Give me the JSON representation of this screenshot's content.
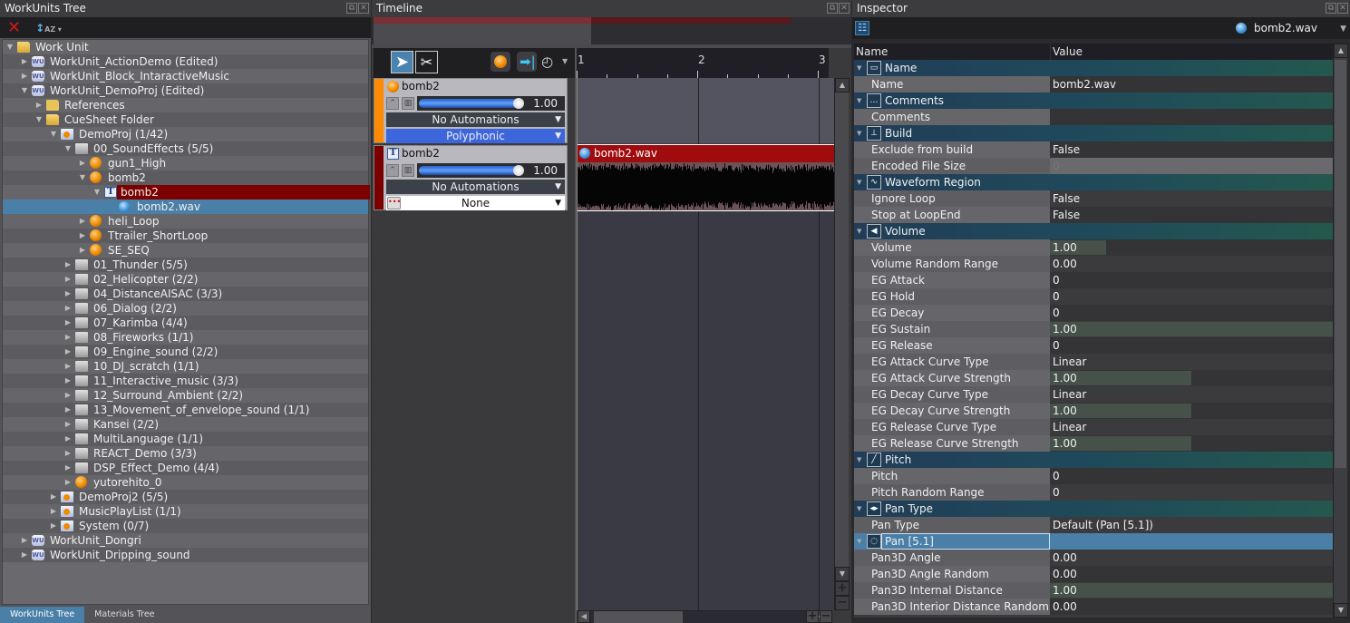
{
  "left_panel": {
    "title": "WorkUnits Tree",
    "toolbar": {
      "delete_icon": "delete-x-icon",
      "sort_icon": "sort-az-icon"
    },
    "tree": [
      {
        "label": "Work Unit",
        "icon": "folder-open",
        "depth": 0,
        "expanded": true
      },
      {
        "label": "WorkUnit_ActionDemo (Edited)",
        "icon": "workunit",
        "depth": 1,
        "expanded": false
      },
      {
        "label": "WorkUnit_Block_IntaractiveMusic",
        "icon": "workunit",
        "depth": 1,
        "expanded": false
      },
      {
        "label": "WorkUnit_DemoProj (Edited)",
        "icon": "workunit",
        "depth": 1,
        "expanded": true
      },
      {
        "label": "References",
        "icon": "folder",
        "depth": 2,
        "expanded": false
      },
      {
        "label": "CueSheet Folder",
        "icon": "folder-open",
        "depth": 2,
        "expanded": true
      },
      {
        "label": "DemoProj (1/42)",
        "icon": "cuesheet",
        "depth": 3,
        "expanded": true
      },
      {
        "label": "00_SoundEffects (5/5)",
        "icon": "gray-folder-open",
        "depth": 4,
        "expanded": true
      },
      {
        "label": "gun1_High",
        "icon": "cue",
        "depth": 5,
        "expanded": false
      },
      {
        "label": "bomb2",
        "icon": "cue",
        "depth": 5,
        "expanded": true
      },
      {
        "label": "bomb2",
        "icon": "track",
        "depth": 6,
        "expanded": true,
        "selected": "red"
      },
      {
        "label": "bomb2.wav",
        "icon": "waveform",
        "depth": 7,
        "selected": "blue"
      },
      {
        "label": "heli_Loop",
        "icon": "cue",
        "depth": 5,
        "expanded": false
      },
      {
        "label": "Ttrailer_ShortLoop",
        "icon": "cue",
        "depth": 5,
        "expanded": false
      },
      {
        "label": "SE_SEQ",
        "icon": "cue",
        "depth": 5,
        "expanded": false
      },
      {
        "label": "01_Thunder (5/5)",
        "icon": "gray-folder",
        "depth": 4,
        "expanded": false
      },
      {
        "label": "02_Helicopter (2/2)",
        "icon": "gray-folder",
        "depth": 4,
        "expanded": false
      },
      {
        "label": "04_DistanceAISAC (3/3)",
        "icon": "gray-folder",
        "depth": 4,
        "expanded": false
      },
      {
        "label": "06_Dialog (2/2)",
        "icon": "gray-folder",
        "depth": 4,
        "expanded": false
      },
      {
        "label": "07_Karimba (4/4)",
        "icon": "gray-folder",
        "depth": 4,
        "expanded": false
      },
      {
        "label": "08_Fireworks (1/1)",
        "icon": "gray-folder",
        "depth": 4,
        "expanded": false
      },
      {
        "label": "09_Engine_sound (2/2)",
        "icon": "gray-folder",
        "depth": 4,
        "expanded": false
      },
      {
        "label": "10_DJ_scratch (1/1)",
        "icon": "gray-folder",
        "depth": 4,
        "expanded": false
      },
      {
        "label": "11_Interactive_music (3/3)",
        "icon": "gray-folder",
        "depth": 4,
        "expanded": false
      },
      {
        "label": "12_Surround_Ambient (2/2)",
        "icon": "gray-folder",
        "depth": 4,
        "expanded": false
      },
      {
        "label": "13_Movement_of_envelope_sound (1/1)",
        "icon": "gray-folder",
        "depth": 4,
        "expanded": false
      },
      {
        "label": "Kansei (2/2)",
        "icon": "gray-folder",
        "depth": 4,
        "expanded": false
      },
      {
        "label": "MultiLanguage (1/1)",
        "icon": "gray-folder",
        "depth": 4,
        "expanded": false
      },
      {
        "label": "REACT_Demo (3/3)",
        "icon": "gray-folder",
        "depth": 4,
        "expanded": false
      },
      {
        "label": "DSP_Effect_Demo (4/4)",
        "icon": "gray-folder",
        "depth": 4,
        "expanded": false
      },
      {
        "label": "yutorehito_0",
        "icon": "cue",
        "depth": 4,
        "expanded": false
      },
      {
        "label": "DemoProj2 (5/5)",
        "icon": "cuesheet",
        "depth": 3,
        "expanded": false
      },
      {
        "label": "MusicPlayList (1/1)",
        "icon": "cuesheet",
        "depth": 3,
        "expanded": false
      },
      {
        "label": "System (0/7)",
        "icon": "cuesheet",
        "depth": 3,
        "expanded": false
      },
      {
        "label": "WorkUnit_Dongri",
        "icon": "workunit",
        "depth": 1,
        "expanded": false
      },
      {
        "label": "WorkUnit_Dripping_sound",
        "icon": "workunit",
        "depth": 1,
        "expanded": false
      }
    ],
    "bottom_tabs": [
      {
        "label": "WorkUnits Tree",
        "active": true
      },
      {
        "label": "Materials Tree",
        "active": false
      }
    ]
  },
  "timeline": {
    "title": "Timeline",
    "ruler_labels": [
      "1",
      "2",
      "3"
    ],
    "tracks": [
      {
        "name": "bomb2",
        "icon": "cue",
        "band_color": "#ff8a00",
        "volume": 1.0,
        "volume_text": "1.00",
        "automation": "No Automations",
        "mode": "Polyphonic",
        "mode_style": "blue"
      },
      {
        "name": "bomb2",
        "icon": "track",
        "band_color": "#7a0000",
        "volume": 1.0,
        "volume_text": "1.00",
        "automation": "No Automations",
        "mode": "None",
        "mode_style": "white"
      }
    ],
    "clip": {
      "label": "bomb2.wav",
      "color": "#a00b0e"
    }
  },
  "inspector": {
    "title": "Inspector",
    "object_name": "bomb2.wav",
    "columns": {
      "name": "Name",
      "value": "Value"
    },
    "sections": [
      {
        "title": "Name",
        "icon": "name-tag",
        "glyph": "▭",
        "rows": [
          {
            "name": "Name",
            "value": "bomb2.wav"
          }
        ]
      },
      {
        "title": "Comments",
        "icon": "comment",
        "glyph": "…",
        "rows": [
          {
            "name": "Comments",
            "value": ""
          }
        ]
      },
      {
        "title": "Build",
        "icon": "build",
        "glyph": "⊥",
        "rows": [
          {
            "name": "Exclude from build",
            "value": "False"
          },
          {
            "name": "Encoded File Size",
            "value": "0",
            "disabled": true
          }
        ]
      },
      {
        "title": "Waveform Region",
        "icon": "waveform-region",
        "glyph": "∿",
        "rows": [
          {
            "name": "Ignore Loop",
            "value": "False"
          },
          {
            "name": "Stop at LoopEnd",
            "value": "False"
          }
        ]
      },
      {
        "title": "Volume",
        "icon": "speaker",
        "glyph": "◀",
        "rows": [
          {
            "name": "Volume",
            "value": "1.00",
            "bar": 0.2
          },
          {
            "name": "Volume Random Range",
            "value": "0.00"
          },
          {
            "name": "EG Attack",
            "value": "0"
          },
          {
            "name": "EG Hold",
            "value": "0"
          },
          {
            "name": "EG Decay",
            "value": "0"
          },
          {
            "name": "EG Sustain",
            "value": "1.00",
            "bar": 1.0
          },
          {
            "name": "EG Release",
            "value": "0"
          },
          {
            "name": "EG Attack Curve Type",
            "value": "Linear"
          },
          {
            "name": "EG Attack Curve Strength",
            "value": "1.00",
            "bar": 0.5
          },
          {
            "name": "EG Decay Curve Type",
            "value": "Linear"
          },
          {
            "name": "EG Decay Curve Strength",
            "value": "1.00",
            "bar": 0.5
          },
          {
            "name": "EG Release Curve Type",
            "value": "Linear"
          },
          {
            "name": "EG Release Curve Strength",
            "value": "1.00",
            "bar": 0.5
          }
        ]
      },
      {
        "title": "Pitch",
        "icon": "pitch",
        "glyph": "╱",
        "rows": [
          {
            "name": "Pitch",
            "value": "0"
          },
          {
            "name": "Pitch Random Range",
            "value": "0"
          }
        ]
      },
      {
        "title": "Pan Type",
        "icon": "pan-type",
        "glyph": "◂▸",
        "rows": [
          {
            "name": "Pan Type",
            "value": "Default (Pan [5.1])"
          }
        ]
      },
      {
        "title": "Pan [5.1]",
        "icon": "pan-surround",
        "glyph": "◌",
        "selected": true,
        "rows": [
          {
            "name": "Pan3D Angle",
            "value": "0.00"
          },
          {
            "name": "Pan3D Angle Random",
            "value": "0.00"
          },
          {
            "name": "Pan3D Internal Distance",
            "value": "1.00",
            "bar": 1.0
          },
          {
            "name": "Pan3D Interior Distance Random",
            "value": "0.00"
          }
        ]
      }
    ]
  }
}
